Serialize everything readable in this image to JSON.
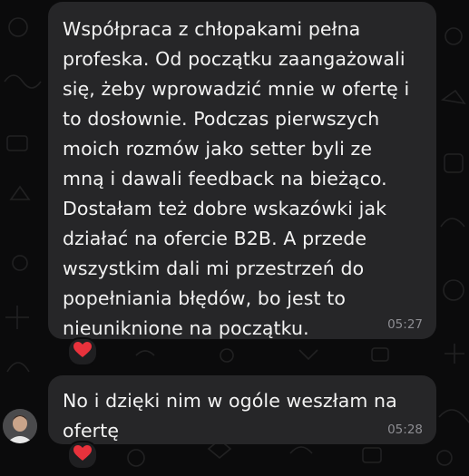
{
  "messages": [
    {
      "text": "Współpraca z chłopakami pełna profeska. Od początku zaangażowali się, żeby wprowadzić mnie w ofertę i to dosłownie. Podczas pierwszych moich rozmów jako setter byli ze mną i dawali feedback na bieżąco. Dostałam też dobre wskazówki jak działać na ofercie B2B. A przede wszystkim dali mi przestrzeń do popełniania błędów, bo jest to nieuniknione na początku.",
      "time": "05:27",
      "reaction": "heart-icon"
    },
    {
      "text": "No i dzięki nim w ogóle weszłam na ofertę",
      "time": "05:28",
      "reaction": "heart-icon"
    }
  ],
  "colors": {
    "background": "#0b0b0c",
    "bubble": "#262628",
    "text": "#f2f2f2",
    "timestamp": "#8d8d92",
    "reaction_heart": "#e8323c"
  }
}
